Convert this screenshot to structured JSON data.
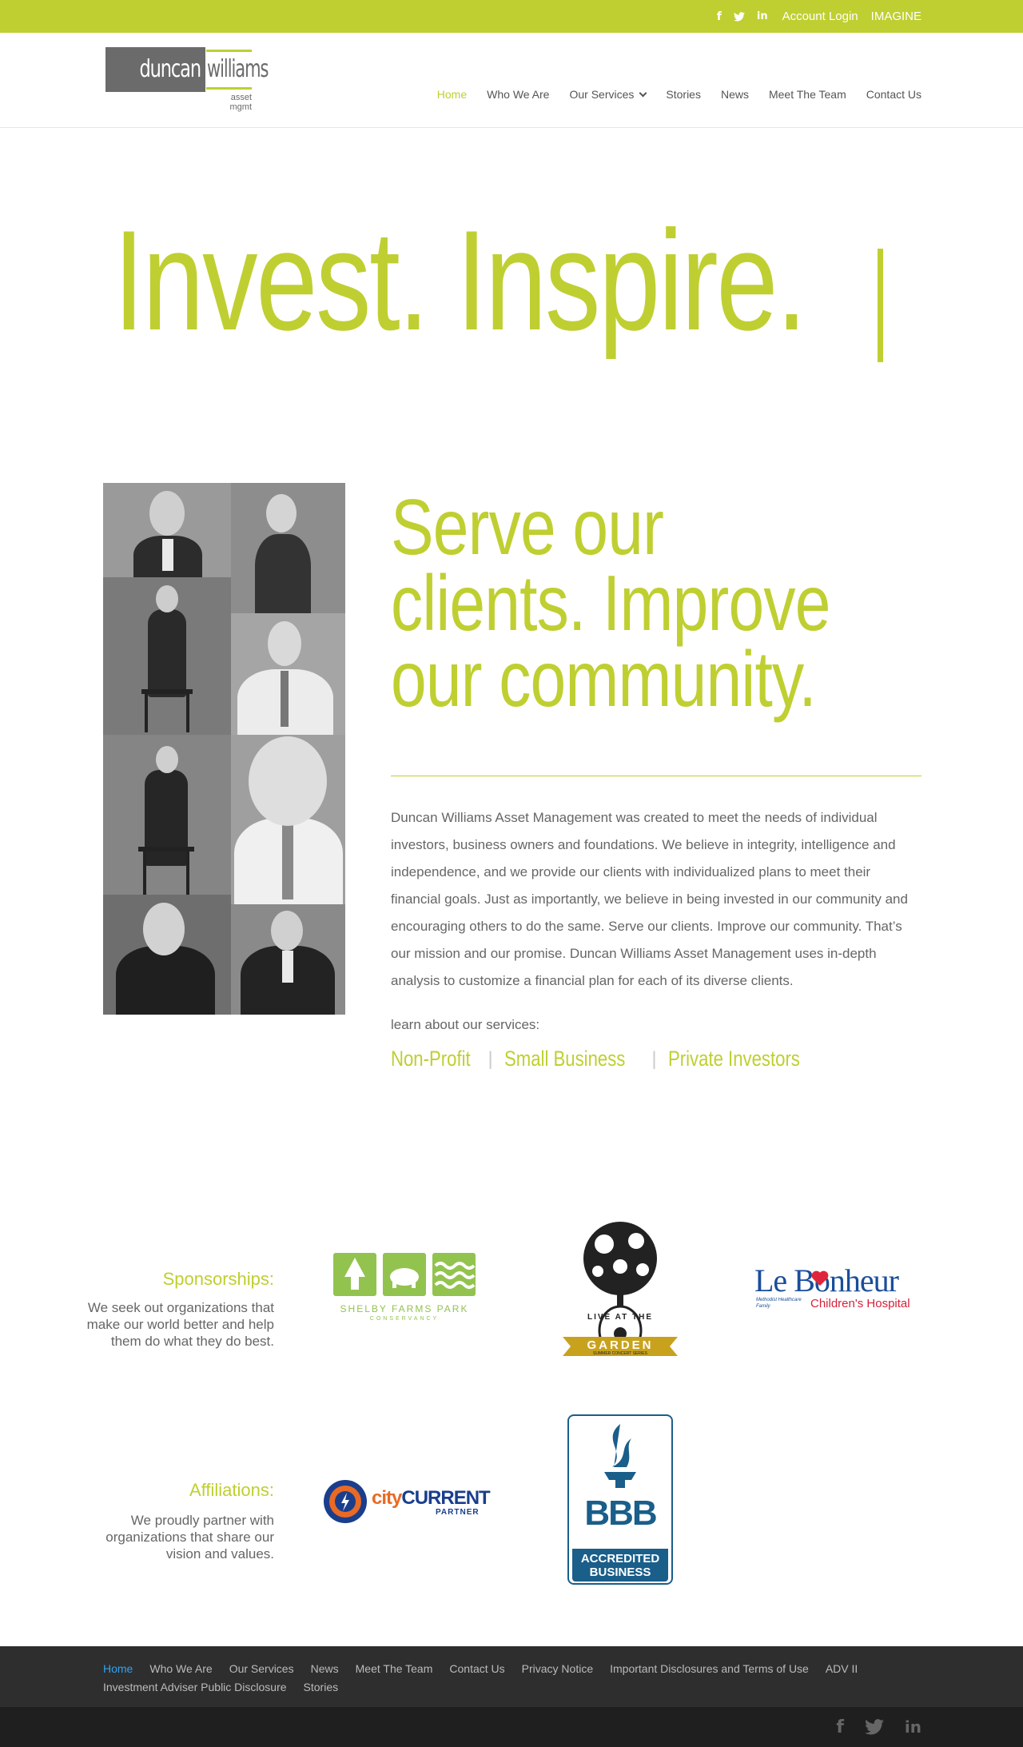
{
  "topbar": {
    "icons": [
      "facebook-icon",
      "twitter-icon",
      "linkedin-icon"
    ],
    "icon_glyphs": [
      "f",
      "t",
      "in"
    ],
    "links": [
      "Account Login",
      "IMAGINE"
    ]
  },
  "logo": {
    "word1": "duncan",
    "word2": "williams",
    "tagline": "asset mgmt"
  },
  "nav": {
    "items": [
      "Home",
      "Who We Are",
      "Our Services",
      "Stories",
      "News",
      "Meet The Team",
      "Contact Us"
    ],
    "active": "Home"
  },
  "hero": {
    "title": "Invest. Inspire."
  },
  "about": {
    "headline_lines": [
      "Serve our",
      "clients. Improve",
      "our community."
    ],
    "body": "Duncan Williams Asset Management was created to meet the needs of individual investors, business owners and foundations. We believe in integrity, intelligence and independence, and we provide our clients with individualized plans to meet their financial goals. Just as importantly, we believe in being invested in our community and encouraging others to do the same. Serve our clients. Improve our community. That’s our mission and our promise. Duncan Williams Asset Management uses in-depth analysis to customize a financial plan for each of its diverse clients.",
    "learn_label": "learn about our services:",
    "services": [
      "Non-Profit",
      "Small Business",
      "Private Investors"
    ],
    "separator": "|"
  },
  "sponsorships": {
    "title": "Sponsorships:",
    "description": "We seek out organizations that make our world better and help them do what they do best.",
    "logos": {
      "shelby_caption": "SHELBY FARMS PARK",
      "shelby_sub": "CONSERVANCY",
      "garden_top": "LIVE AT THE",
      "garden_banner": "GARDEN",
      "garden_sub": "SUMMER CONCERT SERIES",
      "lebonheur_name": "Le Bonheur",
      "lebonheur_sub": "Children's Hospital",
      "lebonheur_family": "Methodist Healthcare Family"
    }
  },
  "affiliations": {
    "title": "Affiliations:",
    "description": "We proudly partner with organizations that share our vision and values.",
    "logos": {
      "city_word1": "city",
      "city_word2": "CURRENT",
      "city_sub": "PARTNER",
      "bbb_letters": "BBB",
      "bbb_line1": "ACCREDITED",
      "bbb_line2": "BUSINESS"
    }
  },
  "footer": {
    "links": [
      "Home",
      "Who We Are",
      "Our Services",
      "News",
      "Meet The Team",
      "Contact Us",
      "Privacy Notice",
      "Important Disclosures and Terms of Use",
      "ADV II",
      "Investment Adviser Public Disclosure",
      "Stories"
    ],
    "active": "Home",
    "social": [
      "facebook-icon",
      "twitter-icon",
      "linkedin-icon"
    ]
  },
  "colors": {
    "accent": "#bfcf31",
    "footer": "#2e2e2e",
    "footer_bottom": "#1f1f1f",
    "link_active": "#2ea3f2"
  }
}
